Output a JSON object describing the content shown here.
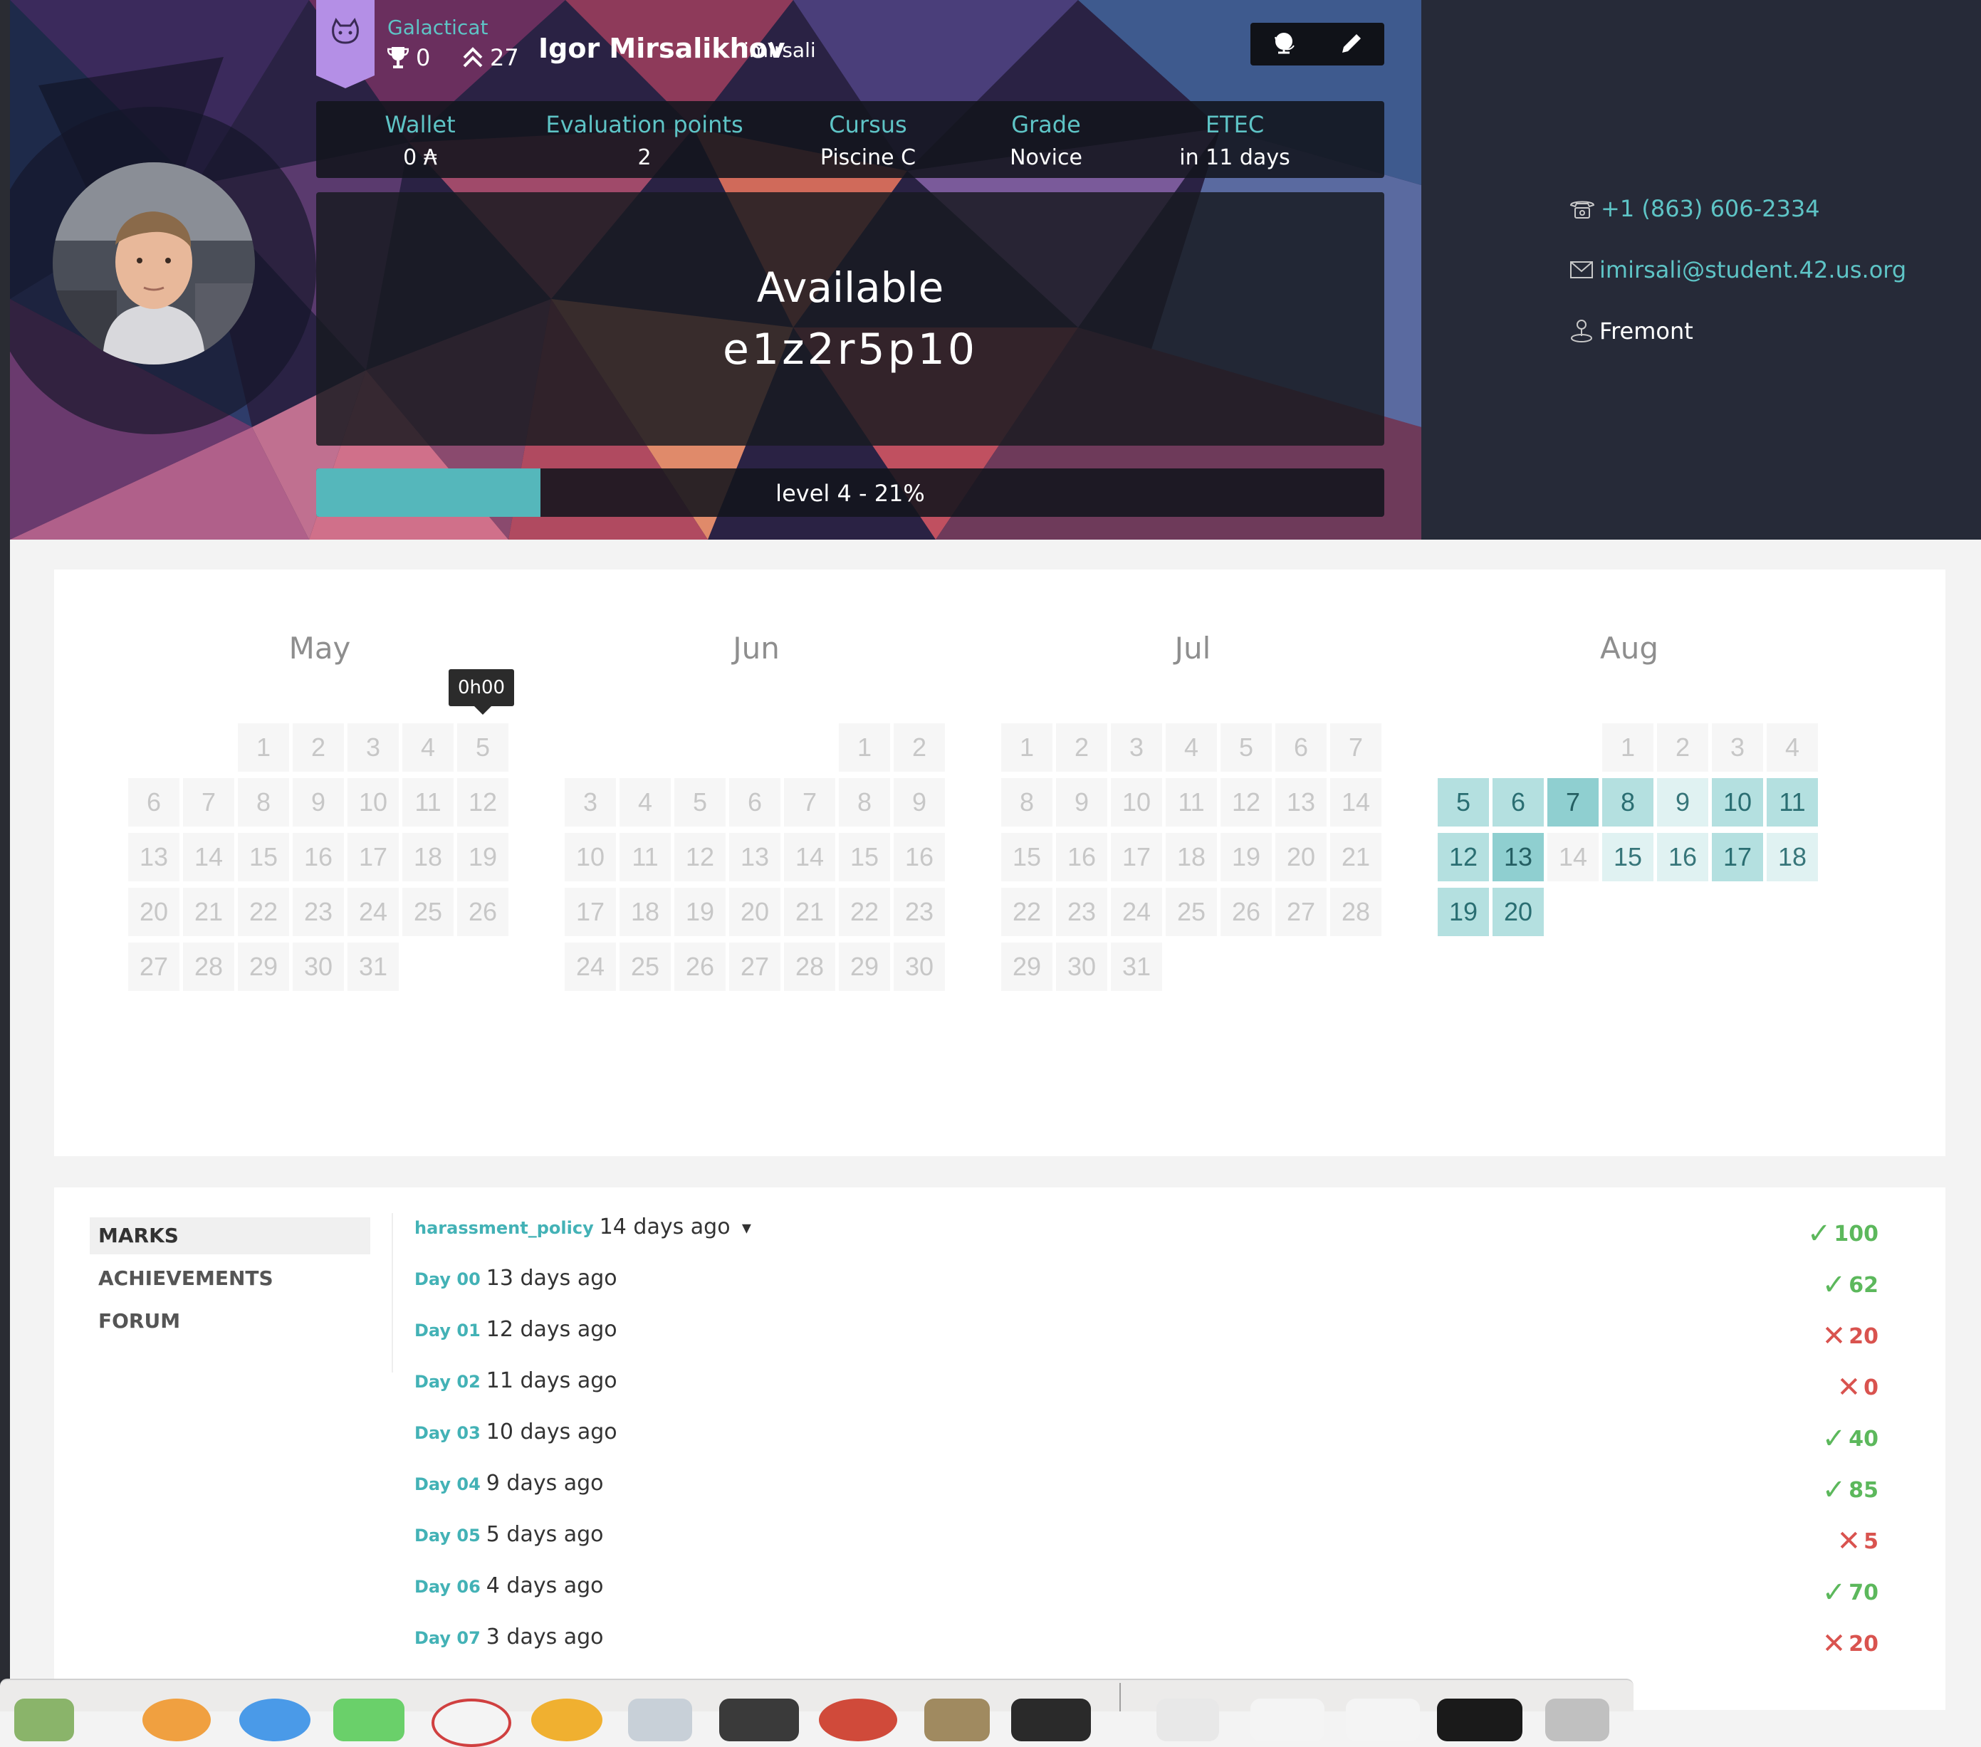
{
  "coalition": {
    "name": "Galacticat",
    "flag_color": "#b48fe6"
  },
  "user": {
    "name": "Igor Mirsalikhov",
    "login": "imirsali",
    "trophies": "0",
    "rank": "27"
  },
  "stats": {
    "wallet": {
      "label": "Wallet",
      "value": "0 ₳"
    },
    "evaluation": {
      "label": "Evaluation points",
      "value": "2"
    },
    "cursus": {
      "label": "Cursus",
      "value": "Piscine C"
    },
    "grade": {
      "label": "Grade",
      "value": "Novice"
    },
    "etec": {
      "label": "ETEC",
      "value": "in 11 days"
    }
  },
  "location": {
    "status": "Available",
    "host": "e1z2r5p10"
  },
  "level": {
    "text": "level 4 - 21%",
    "progress_percent": 21
  },
  "contact": {
    "phone": "+1 (863) 606-2334",
    "email": "imirsali@student.42.us.org",
    "campus": "Fremont"
  },
  "calendar": {
    "tooltip": "0h00",
    "months": [
      {
        "name": "May",
        "first_weekday": 2,
        "days": 31,
        "active": {}
      },
      {
        "name": "Jun",
        "first_weekday": 5,
        "days": 30,
        "active": {}
      },
      {
        "name": "Jul",
        "first_weekday": 0,
        "days": 31,
        "active": {}
      },
      {
        "name": "Aug",
        "first_weekday": 3,
        "days": 20,
        "active": {
          "5": "l2",
          "6": "l2",
          "7": "l3",
          "8": "l2",
          "9": "l1",
          "10": "l2",
          "11": "l2",
          "12": "l2",
          "13": "l3",
          "15": "l1",
          "16": "l1",
          "17": "l2",
          "18": "l1",
          "19": "l2",
          "20": "l2"
        }
      }
    ]
  },
  "tabs": [
    "MARKS",
    "ACHIEVEMENTS",
    "FORUM"
  ],
  "marks": [
    {
      "name": "harassment_policy",
      "time": "14 days ago",
      "score": "100",
      "passed": true,
      "dropdown": true
    },
    {
      "name": "Day 00",
      "time": "13 days ago",
      "score": "62",
      "passed": true
    },
    {
      "name": "Day 01",
      "time": "12 days ago",
      "score": "20",
      "passed": false
    },
    {
      "name": "Day 02",
      "time": "11 days ago",
      "score": "0",
      "passed": false
    },
    {
      "name": "Day 03",
      "time": "10 days ago",
      "score": "40",
      "passed": true
    },
    {
      "name": "Day 04",
      "time": "9 days ago",
      "score": "85",
      "passed": true
    },
    {
      "name": "Day 05",
      "time": "5 days ago",
      "score": "5",
      "passed": false
    },
    {
      "name": "Day 06",
      "time": "4 days ago",
      "score": "70",
      "passed": true
    },
    {
      "name": "Day 07",
      "time": "3 days ago",
      "score": "20",
      "passed": false
    }
  ],
  "colors": {
    "accent": "#5ec4c6",
    "pass": "#5cb85c",
    "fail": "#d9534f"
  }
}
